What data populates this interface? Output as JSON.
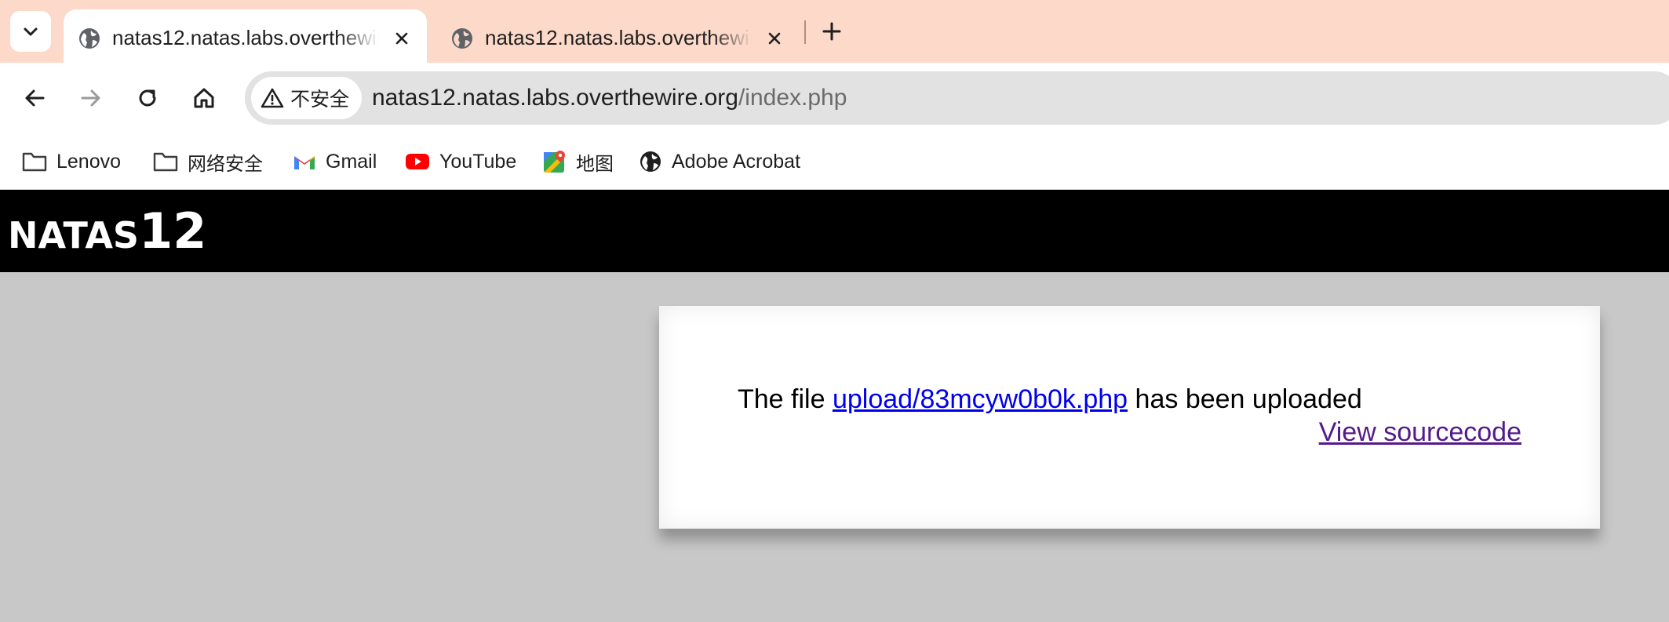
{
  "browser": {
    "tabs": [
      {
        "title": "natas12.natas.labs.overthewire.org",
        "active": true
      },
      {
        "title": "natas12.natas.labs.overthewire.org",
        "active": false
      }
    ],
    "security_label": "不安全",
    "url_host": "natas12.natas.labs.overthewire.org",
    "url_path": "/index.php",
    "bookmarks": [
      {
        "label": "Lenovo",
        "icon": "folder-icon"
      },
      {
        "label": "网络安全",
        "icon": "folder-icon"
      },
      {
        "label": "Gmail",
        "icon": "gmail-icon"
      },
      {
        "label": "YouTube",
        "icon": "youtube-icon"
      },
      {
        "label": "地图",
        "icon": "maps-icon"
      },
      {
        "label": "Adobe Acrobat",
        "icon": "globe-icon"
      }
    ]
  },
  "page": {
    "logo_prefix": "NATAS",
    "logo_number": "12",
    "message_before": "The file ",
    "uploaded_file_link": "upload/83mcyw0b0k.php",
    "message_after": " has been uploaded",
    "view_source_label": "View sourcecode"
  },
  "colors": {
    "tabstrip": "#fcd9c9",
    "banner": "#000000",
    "page_background": "#c8c8c8",
    "link": "#0000ee",
    "visited_link": "#551a8b"
  }
}
